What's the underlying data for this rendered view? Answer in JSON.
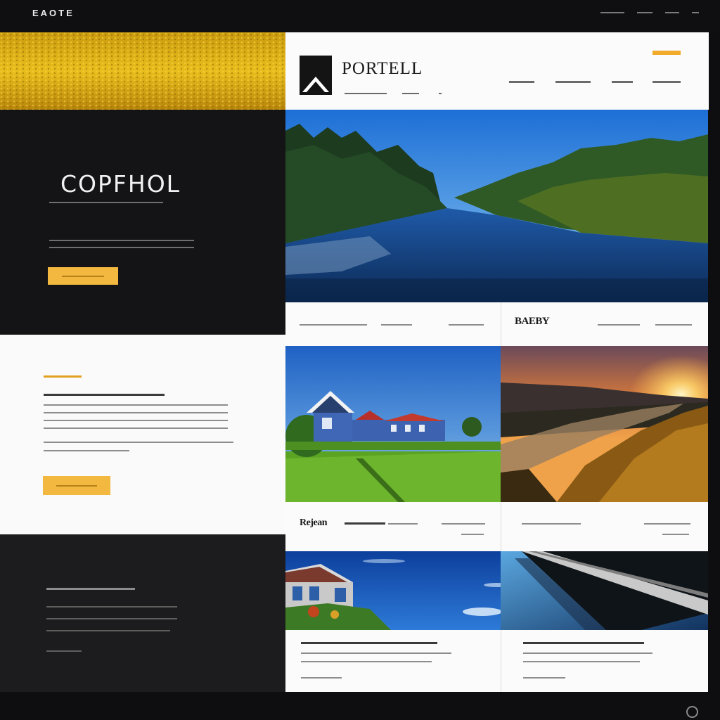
{
  "header": {
    "brand": "EAOTE",
    "nav_item_count_label": ""
  },
  "hero": {
    "title": "COPFHOL"
  },
  "main_header": {
    "logo_text": "PORTELL"
  },
  "sections": {
    "gallery_title": "BAEBY",
    "card_title": "Rejean"
  },
  "colors": {
    "accent": "#f2b840",
    "dark_bg": "#141416",
    "light_bg": "#fbfbfb"
  },
  "icons": {
    "logo": "mountain-logo-icon",
    "scroll": "circle-icon"
  }
}
